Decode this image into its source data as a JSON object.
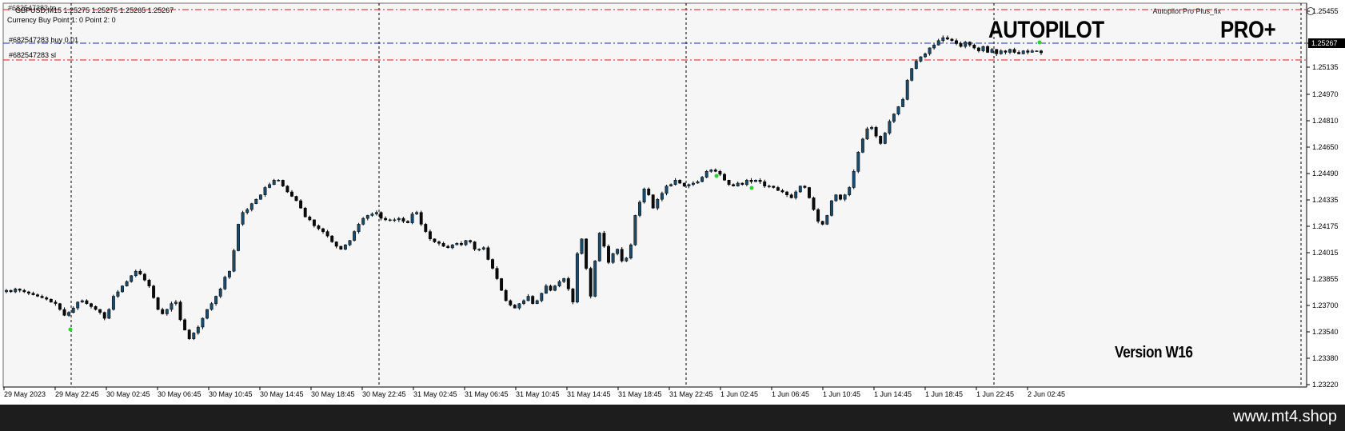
{
  "chart_data": {
    "type": "candlestick",
    "symbol_header": "GBPUSD,M15 1.25275 1.25275 1.25265 1.25267",
    "info_line": "Currency Buy Point 1: 0 Point 2: 0",
    "overlapped_label": "#682547283 tp",
    "price_axis_labels": [
      "1.25455",
      "1.25267",
      "1.25135",
      "1.24970",
      "1.24810",
      "1.24650",
      "1.24490",
      "1.24335",
      "1.24175",
      "1.24015",
      "1.23855",
      "1.23700",
      "1.23540",
      "1.23380",
      "1.23220"
    ],
    "time_axis_labels": [
      "29 May 2023",
      "29 May 22:45",
      "30 May 02:45",
      "30 May 06:45",
      "30 May 10:45",
      "30 May 14:45",
      "30 May 18:45",
      "30 May 22:45",
      "31 May 02:45",
      "31 May 06:45",
      "31 May 10:45",
      "31 May 14:45",
      "31 May 18:45",
      "31 May 22:45",
      "1 Jun 02:45",
      "1 Jun 06:45",
      "1 Jun 10:45",
      "1 Jun 14:45",
      "1 Jun 18:45",
      "1 Jun 22:45",
      "2 Jun 02:45"
    ],
    "current_price": "1.25267",
    "levels": [
      {
        "name": "tp",
        "price": 1.25455,
        "label": "#682547283 tp",
        "color": "#e4191c"
      },
      {
        "name": "buy",
        "price": 1.25267,
        "label": "#682547283 buy 0.01",
        "color": "#1f33a6"
      },
      {
        "name": "sl",
        "price": 1.25175,
        "label": "#682547283 sl",
        "color": "#e4191c"
      }
    ],
    "ylim": [
      1.2315,
      1.2555
    ],
    "closes": [
      1.2365,
      1.2364,
      1.2366,
      1.2365,
      1.2364,
      1.2363,
      1.2362,
      1.2361,
      1.236,
      1.2359,
      1.2357,
      1.2356,
      1.2352,
      1.2348,
      1.235,
      1.2353,
      1.2357,
      1.2358,
      1.2356,
      1.2354,
      1.2352,
      1.235,
      1.2346,
      1.2352,
      1.2361,
      1.2364,
      1.2368,
      1.2371,
      1.2375,
      1.2378,
      1.2376,
      1.2372,
      1.2368,
      1.236,
      1.2352,
      1.2349,
      1.2352,
      1.2356,
      1.2357,
      1.2345,
      1.2338,
      1.2332,
      1.2336,
      1.234,
      1.2346,
      1.2352,
      1.2356,
      1.2361,
      1.2366,
      1.2374,
      1.2378,
      1.2392,
      1.241,
      1.2418,
      1.242,
      1.2424,
      1.2427,
      1.243,
      1.2435,
      1.2437,
      1.244,
      1.244,
      1.2436,
      1.2432,
      1.2429,
      1.2426,
      1.2421,
      1.2415,
      1.2413,
      1.2409,
      1.2407,
      1.2405,
      1.2402,
      1.2398,
      1.2395,
      1.2393,
      1.2396,
      1.2399,
      1.2405,
      1.241,
      1.2414,
      1.2416,
      1.2417,
      1.2418,
      1.2414,
      1.2413,
      1.2413,
      1.2413,
      1.2414,
      1.2412,
      1.2411,
      1.2417,
      1.2418,
      1.241,
      1.2405,
      1.24,
      1.2398,
      1.2397,
      1.2395,
      1.2394,
      1.2396,
      1.2397,
      1.2396,
      1.2399,
      1.2398,
      1.2393,
      1.2393,
      1.2394,
      1.2386,
      1.238,
      1.2373,
      1.2365,
      1.2358,
      1.2355,
      1.2353,
      1.2356,
      1.2358,
      1.2361,
      1.2356,
      1.2358,
      1.2363,
      1.2368,
      1.2365,
      1.2368,
      1.2371,
      1.2373,
      1.2366,
      1.2357,
      1.239,
      1.24,
      1.238,
      1.2361,
      1.2385,
      1.2404,
      1.2395,
      1.2384,
      1.239,
      1.2393,
      1.2385,
      1.2387,
      1.2396,
      1.2416,
      1.2425,
      1.2434,
      1.243,
      1.2421,
      1.2427,
      1.2431,
      1.2436,
      1.2437,
      1.244,
      1.2438,
      1.2436,
      1.2437,
      1.2438,
      1.2439,
      1.2442,
      1.2446,
      1.2447,
      1.2446,
      1.2444,
      1.244,
      1.2437,
      1.2436,
      1.2438,
      1.2437,
      1.244,
      1.2439,
      1.244,
      1.2439,
      1.2436,
      1.2436,
      1.2435,
      1.2433,
      1.2432,
      1.243,
      1.2428,
      1.2432,
      1.2436,
      1.2435,
      1.2428,
      1.242,
      1.2412,
      1.241,
      1.2416,
      1.2426,
      1.243,
      1.2427,
      1.243,
      1.2435,
      1.2446,
      1.2459,
      1.2468,
      1.2475,
      1.2476,
      1.247,
      1.2465,
      1.2472,
      1.248,
      1.2485,
      1.249,
      1.2495,
      1.2508,
      1.2516,
      1.2521,
      1.2524,
      1.2526,
      1.253,
      1.2532,
      1.2535,
      1.2537,
      1.2536,
      1.2535,
      1.2533,
      1.2531,
      1.2534,
      1.2532,
      1.253,
      1.2528,
      1.2531,
      1.2527,
      1.2529,
      1.2526,
      1.2528,
      1.2527,
      1.2529,
      1.2527,
      1.2526,
      1.2528,
      1.2527,
      1.2528,
      1.2528,
      1.25267
    ],
    "ma_color": "#2e7d32"
  },
  "overlay": {
    "autopilot": "AUTOPILOT",
    "pro_plus": "PRO+",
    "version": "Version W16",
    "indicator_name": "Autopilot Pro Plus_fix"
  },
  "site": "www.mt4.shop",
  "colors": {
    "bull": "#1a4b6b",
    "bear": "#0b0b0b",
    "grid": "#000000",
    "sl_tp": "#e4191c",
    "buy_line": "#1f33a6",
    "chart_bg": "#f6f6f6"
  }
}
